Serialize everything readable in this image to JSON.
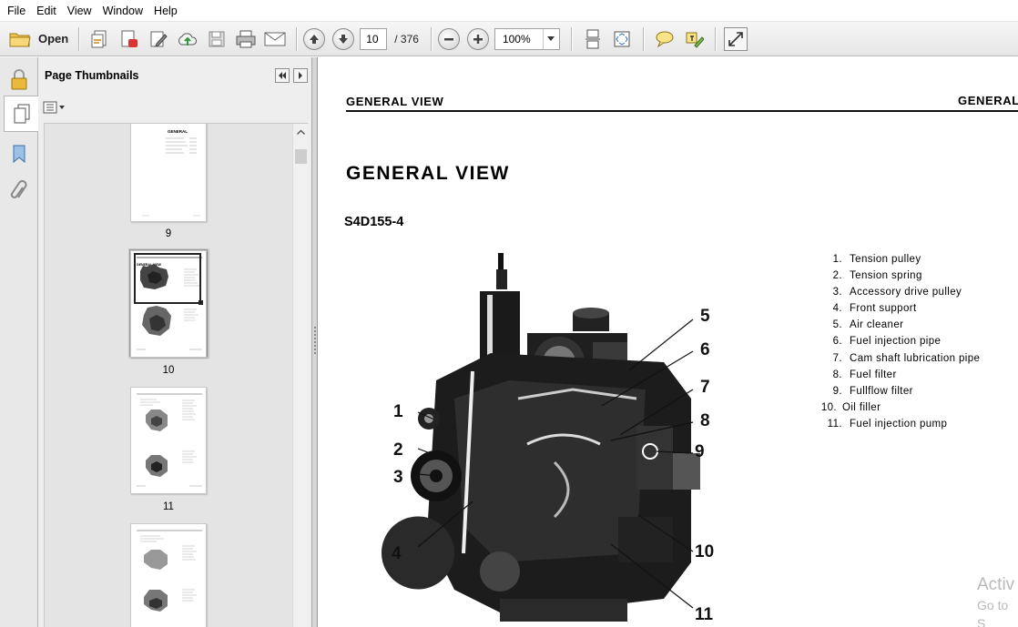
{
  "menu": [
    "File",
    "Edit",
    "View",
    "Window",
    "Help"
  ],
  "toolbar": {
    "open_label": "Open",
    "current_page": "10",
    "page_total": "/ 376",
    "zoom": "100%"
  },
  "panel": {
    "title": "Page Thumbnails",
    "thumbnails": [
      {
        "label": "9",
        "heading": "GENERAL"
      },
      {
        "label": "10",
        "heading": "GENERAL VIEW"
      },
      {
        "label": "11",
        "heading": ""
      },
      {
        "label": "",
        "heading": ""
      }
    ]
  },
  "document": {
    "header_left": "GENERAL VIEW",
    "header_right": "GENERAL",
    "title": "GENERAL VIEW",
    "model": "S4D155-4",
    "parts": [
      {
        "num": "1.",
        "name": "Tension pulley"
      },
      {
        "num": "2.",
        "name": "Tension spring"
      },
      {
        "num": "3.",
        "name": "Accessory drive pulley"
      },
      {
        "num": "4.",
        "name": "Front support"
      },
      {
        "num": "5.",
        "name": "Air cleaner"
      },
      {
        "num": "6.",
        "name": "Fuel injection pipe"
      },
      {
        "num": "7.",
        "name": "Cam shaft lubrication pipe"
      },
      {
        "num": "8.",
        "name": "Fuel filter"
      },
      {
        "num": "9.",
        "name": "Fullflow filter"
      },
      {
        "num": "10.",
        "name": "Oil filler"
      },
      {
        "num": "11.",
        "name": "Fuel injection pump"
      }
    ],
    "callouts": [
      "1",
      "2",
      "3",
      "4",
      "5",
      "6",
      "7",
      "8",
      "9",
      "10",
      "11"
    ]
  },
  "watermark": {
    "line1": "Activ",
    "line2": "Go to S"
  },
  "colors": {
    "toolbar": "#e9e9e9",
    "panel": "#eeeeee",
    "selected_thumb": "#9a9a9a"
  }
}
